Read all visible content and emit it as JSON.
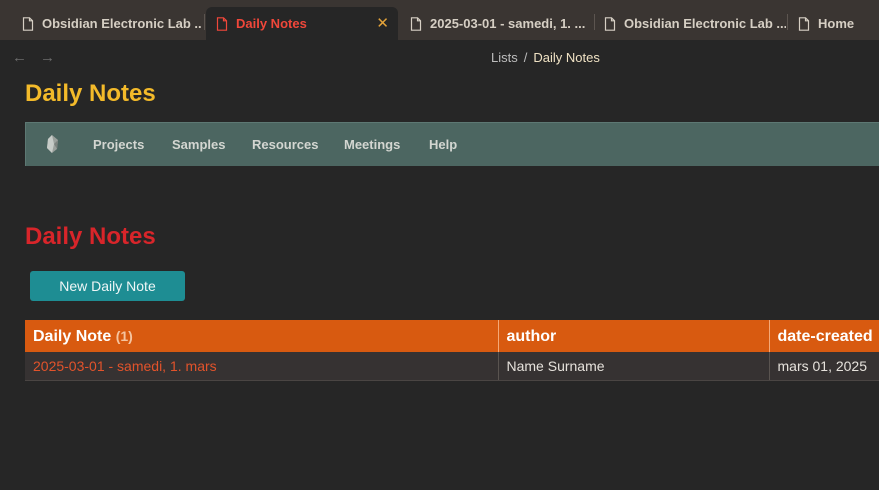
{
  "tabs": [
    {
      "label": "Obsidian Electronic Lab ...",
      "active": false
    },
    {
      "label": "Daily Notes",
      "active": true
    },
    {
      "label": "2025-03-01 - samedi, 1. ...",
      "active": false
    },
    {
      "label": "Obsidian Electronic Lab ...",
      "active": false
    },
    {
      "label": "Home",
      "active": false
    }
  ],
  "tab_close_glyph": "✕",
  "nav": {
    "back_icon": "arrow-left-icon",
    "forward_icon": "arrow-right-icon"
  },
  "breadcrumb": {
    "parent": "Lists",
    "separator": "/",
    "current": "Daily Notes"
  },
  "page_title": "Daily Notes",
  "menu": {
    "logo_icon": "obsidian-logo-icon",
    "items": [
      "Projects",
      "Samples",
      "Resources",
      "Meetings",
      "Help"
    ]
  },
  "section_title": "Daily Notes",
  "new_button_label": "New Daily Note",
  "table": {
    "headers": [
      "Daily Note",
      "author",
      "date-created"
    ],
    "count": "(1)",
    "rows": [
      {
        "note": "2025-03-01 - samedi, 1. mars",
        "author": "Name Surname",
        "date_created": "mars 01, 2025"
      }
    ]
  },
  "colors": {
    "background": "#262626",
    "tabbar": "#3a3532",
    "active_tab_text": "#f0473a",
    "page_title": "#f3ba2a",
    "menubar": "#4c6661",
    "section_title": "#d8252a",
    "button": "#1e8d93",
    "table_header": "#d85a10",
    "link": "#e2532b"
  }
}
